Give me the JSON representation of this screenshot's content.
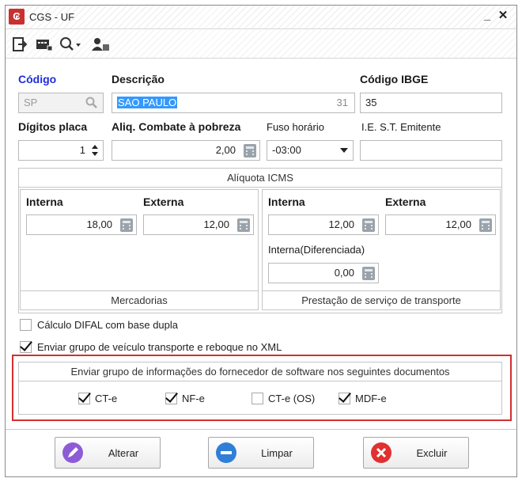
{
  "window": {
    "title": "CGS - UF",
    "minimize": "_",
    "close": "✕"
  },
  "toolbar": {
    "icons": [
      "export-icon",
      "card-icon",
      "search-icon",
      "user-icon"
    ]
  },
  "form": {
    "codigo_label": "Código",
    "codigo_value": "SP",
    "descricao_label": "Descrição",
    "descricao_value": "SAO PAULO",
    "descricao_counter": "31",
    "ibge_label": "Código IBGE",
    "ibge_value": "35",
    "digitos_label": "Dígitos placa",
    "digitos_value": "1",
    "aliq_pobreza_label": "Aliq. Combate à pobreza",
    "aliq_pobreza_value": "2,00",
    "fuso_label": "Fuso horário",
    "fuso_value": "-03:00",
    "iest_label": "I.E. S.T.  Emitente",
    "iest_value": ""
  },
  "icms": {
    "title": "Alíquota ICMS",
    "mercadorias": {
      "interna_label": "Interna",
      "interna_value": "18,00",
      "externa_label": "Externa",
      "externa_value": "12,00",
      "footer": "Mercadorias"
    },
    "transporte": {
      "interna_label": "Interna",
      "interna_value": "12,00",
      "externa_label": "Externa",
      "externa_value": "12,00",
      "dif_label": "Interna(Diferenciada)",
      "dif_value": "0,00",
      "footer": "Prestação de serviço de transporte"
    }
  },
  "options": {
    "difal": {
      "label": "Cálculo DIFAL com base dupla",
      "checked": false
    },
    "veiculo": {
      "label": "Enviar grupo de veículo transporte e reboque no XML",
      "checked": true
    }
  },
  "software_group": {
    "title": "Enviar grupo de informações do fornecedor de software nos seguintes documentos",
    "items": [
      {
        "label": "CT-e",
        "checked": true
      },
      {
        "label": "NF-e",
        "checked": true
      },
      {
        "label": "CT-e (OS)",
        "checked": false
      },
      {
        "label": "MDF-e",
        "checked": true
      }
    ]
  },
  "buttons": {
    "alterar": "Alterar",
    "limpar": "Limpar",
    "excluir": "Excluir"
  },
  "colors": {
    "accent_label": "#1e2ed8",
    "highlight_border": "#d32f2f",
    "selection": "#3399ff"
  }
}
